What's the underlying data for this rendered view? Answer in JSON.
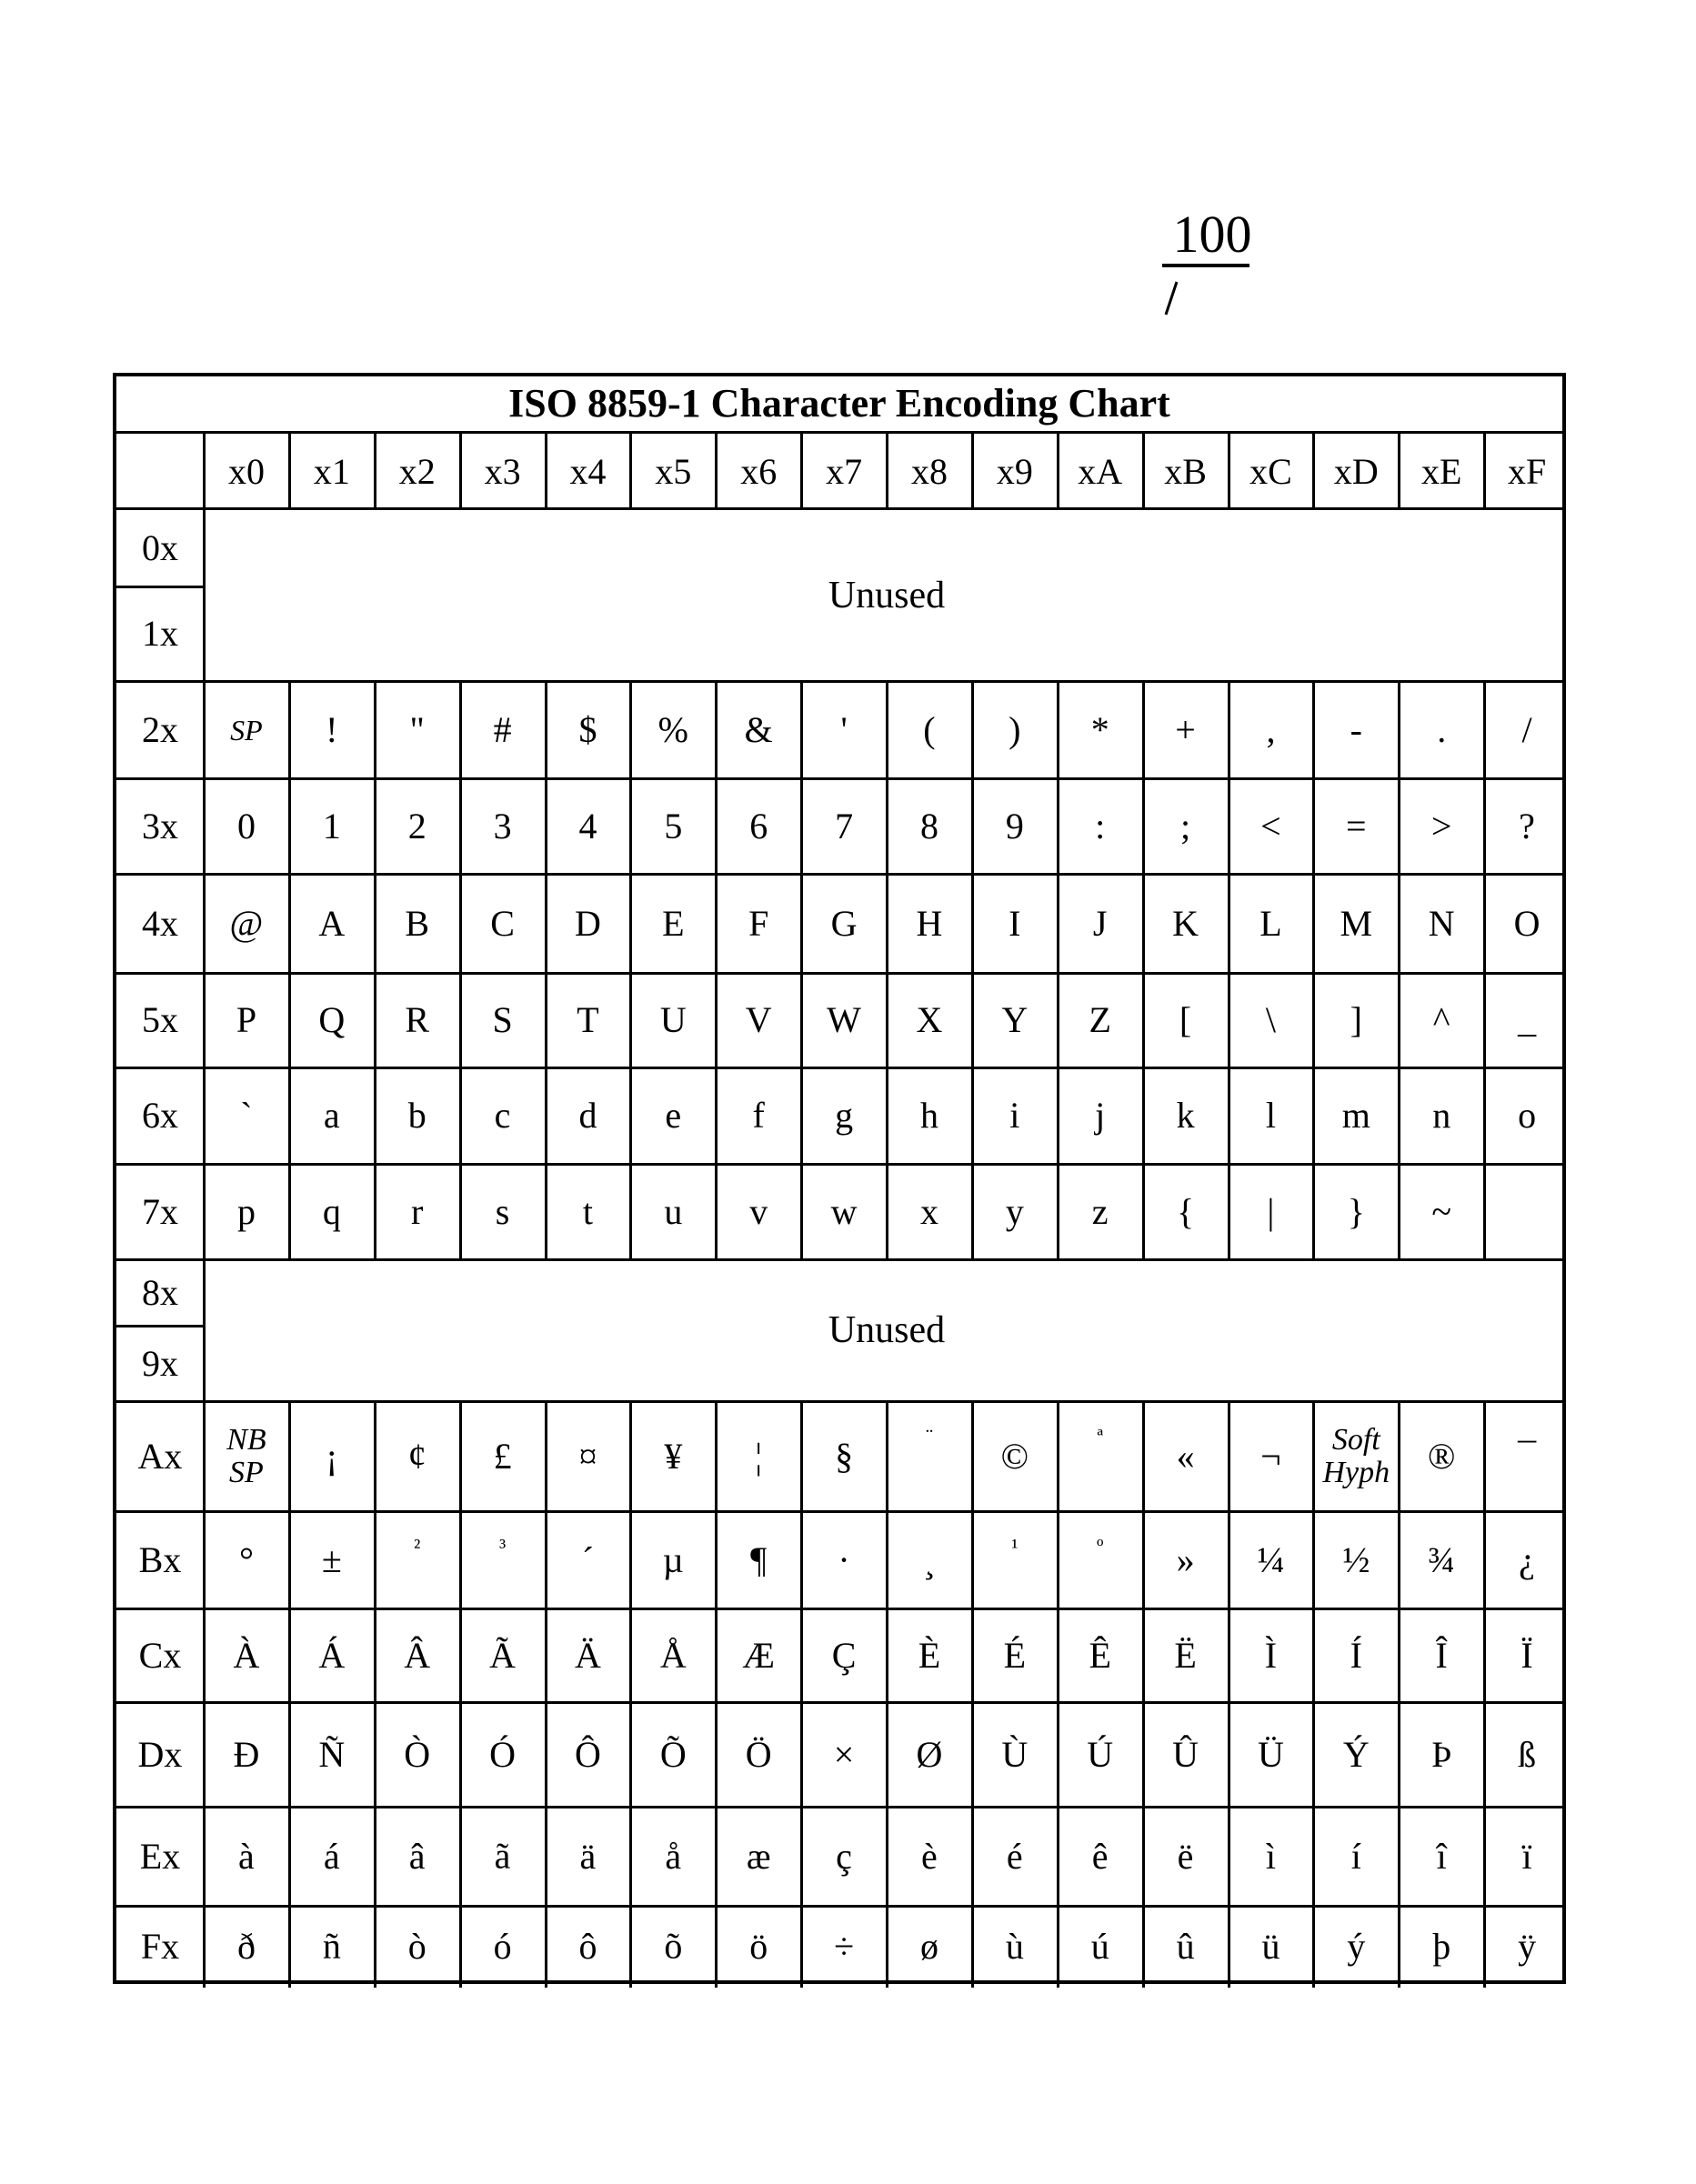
{
  "figure": {
    "reference_number": "100",
    "title": "ISO 8859-1 Character Encoding Chart"
  },
  "column_headers": [
    "x0",
    "x1",
    "x2",
    "x3",
    "x4",
    "x5",
    "x6",
    "x7",
    "x8",
    "x9",
    "xA",
    "xB",
    "xC",
    "xD",
    "xE",
    "xF"
  ],
  "row_headers": [
    "0x",
    "1x",
    "2x",
    "3x",
    "4x",
    "5x",
    "6x",
    "7x",
    "8x",
    "9x",
    "Ax",
    "Bx",
    "Cx",
    "Dx",
    "Ex",
    "Fx"
  ],
  "unused_blocks": [
    {
      "rows": [
        "0x",
        "1x"
      ],
      "label": "Unused"
    },
    {
      "rows": [
        "8x",
        "9x"
      ],
      "label": "Unused"
    }
  ],
  "rows": {
    "2x": [
      "SP",
      "!",
      "\"",
      "#",
      "$",
      "%",
      "&",
      "'",
      "(",
      ")",
      "*",
      "+",
      ",",
      "-",
      ".",
      "/"
    ],
    "3x": [
      "0",
      "1",
      "2",
      "3",
      "4",
      "5",
      "6",
      "7",
      "8",
      "9",
      ":",
      ";",
      "<",
      "=",
      ">",
      "?"
    ],
    "4x": [
      "@",
      "A",
      "B",
      "C",
      "D",
      "E",
      "F",
      "G",
      "H",
      "I",
      "J",
      "K",
      "L",
      "M",
      "N",
      "O"
    ],
    "5x": [
      "P",
      "Q",
      "R",
      "S",
      "T",
      "U",
      "V",
      "W",
      "X",
      "Y",
      "Z",
      "[",
      "\\",
      "]",
      "^",
      "_"
    ],
    "6x": [
      "`",
      "a",
      "b",
      "c",
      "d",
      "e",
      "f",
      "g",
      "h",
      "i",
      "j",
      "k",
      "l",
      "m",
      "n",
      "o"
    ],
    "7x": [
      "p",
      "q",
      "r",
      "s",
      "t",
      "u",
      "v",
      "w",
      "x",
      "y",
      "z",
      "{",
      "|",
      "}",
      "~",
      ""
    ],
    "Ax": [
      "NB SP",
      "¡",
      "¢",
      "£",
      "¤",
      "¥",
      "¦",
      "§",
      "¨",
      "©",
      "ª",
      "«",
      "¬",
      "Soft Hyph",
      "®",
      "¯"
    ],
    "Bx": [
      "°",
      "±",
      "²",
      "³",
      "´",
      "µ",
      "¶",
      "·",
      "¸",
      "¹",
      "º",
      "»",
      "¼",
      "½",
      "¾",
      "¿"
    ],
    "Cx": [
      "À",
      "Á",
      "Â",
      "Ã",
      "Ä",
      "Å",
      "Æ",
      "Ç",
      "È",
      "É",
      "Ê",
      "Ë",
      "Ì",
      "Í",
      "Î",
      "Ï"
    ],
    "Dx": [
      "Ð",
      "Ñ",
      "Ò",
      "Ó",
      "Ô",
      "Õ",
      "Ö",
      "×",
      "Ø",
      "Ù",
      "Ú",
      "Û",
      "Ü",
      "Ý",
      "Þ",
      "ß"
    ],
    "Ex": [
      "à",
      "á",
      "â",
      "ã",
      "ä",
      "å",
      "æ",
      "ç",
      "è",
      "é",
      "ê",
      "ë",
      "ì",
      "í",
      "î",
      "ï"
    ],
    "Fx": [
      "ð",
      "ñ",
      "ò",
      "ó",
      "ô",
      "õ",
      "ö",
      "÷",
      "ø",
      "ù",
      "ú",
      "û",
      "ü",
      "ý",
      "þ",
      "ÿ"
    ]
  },
  "special_labels": {
    "2x.0": "italic",
    "Ax.0": "italic",
    "Ax.13": "italic"
  }
}
